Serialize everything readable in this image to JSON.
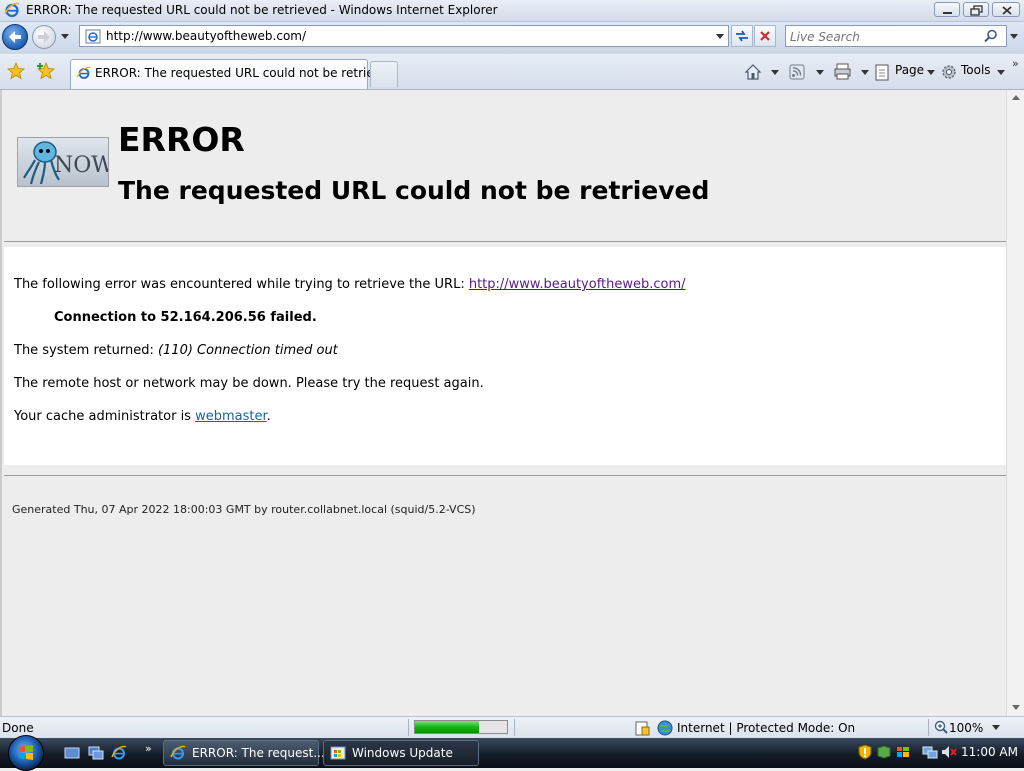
{
  "window": {
    "title": "ERROR: The requested URL could not be retrieved - Windows Internet Explorer"
  },
  "address_bar": {
    "url": "http://www.beautyoftheweb.com/"
  },
  "search": {
    "placeholder": "Live Search"
  },
  "tab": {
    "label": "ERROR: The requested URL could not be retrieved"
  },
  "command_bar": {
    "page_label": "Page",
    "tools_label": "Tools"
  },
  "page": {
    "heading": "ERROR",
    "subheading": "The requested URL could not be retrieved",
    "logo_text": "NOW",
    "intro_text": "The following error was encountered while trying to retrieve the URL: ",
    "intro_link": "http://www.beautyoftheweb.com/",
    "error_detail": "Connection to 52.164.206.56 failed.",
    "system_returned_label": "The system returned: ",
    "system_returned_value": "(110) Connection timed out",
    "remote_host_text": "The remote host or network may be down. Please try the request again.",
    "cache_admin_text": "Your cache administrator is ",
    "cache_admin_link": "webmaster",
    "cache_admin_suffix": ".",
    "footer": "Generated Thu, 07 Apr 2022 18:00:03 GMT by router.collabnet.local (squid/5.2-VCS)"
  },
  "status_bar": {
    "status": "Done",
    "progress_fraction": 0.7,
    "zone": "Internet | Protected Mode: On",
    "zoom": "100%"
  },
  "taskbar": {
    "buttons": [
      {
        "label": "ERROR: The request..."
      },
      {
        "label": "Windows Update"
      }
    ],
    "clock": "11:00 AM"
  },
  "colors": {
    "visited_link": "#551a8b",
    "link": "#1a5fb0",
    "progress_green": "#19b319"
  }
}
